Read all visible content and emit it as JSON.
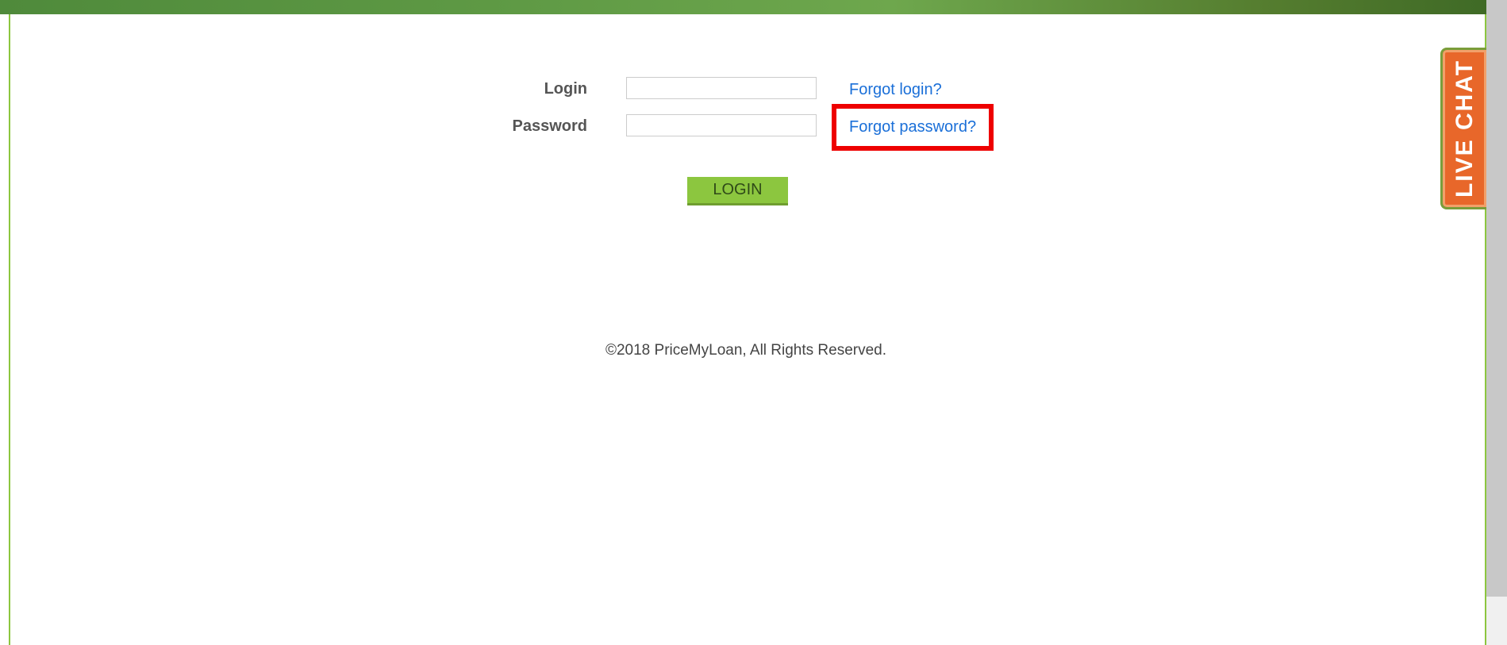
{
  "form": {
    "login_label": "Login",
    "password_label": "Password",
    "login_value": "",
    "password_value": "",
    "forgot_login": "Forgot login?",
    "forgot_password": "Forgot password?",
    "submit_label": "LOGIN"
  },
  "footer": {
    "copyright": "©2018 PriceMyLoan, All Rights Reserved."
  },
  "live_chat": {
    "label": "LIVE CHAT"
  },
  "colors": {
    "header_bar": "#5f9a45",
    "border": "#8cc63f",
    "button": "#8cc63f",
    "link": "#1a6fd8",
    "highlight": "#ee0000",
    "live_chat": "#e8672a"
  }
}
